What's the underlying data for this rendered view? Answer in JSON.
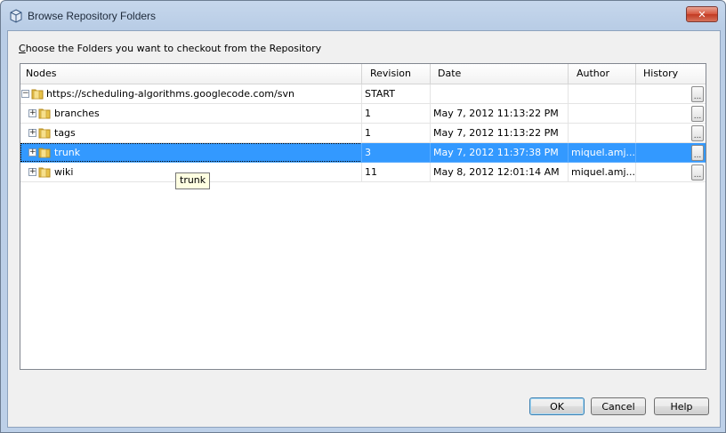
{
  "window": {
    "title": "Browse Repository Folders",
    "close_glyph": "✕"
  },
  "instruction": {
    "prefix": "C",
    "rest": "hoose the Folders you want to checkout from the Repository"
  },
  "table": {
    "columns": [
      "Nodes",
      "Revision",
      "Date",
      "Author",
      "History"
    ],
    "rows": [
      {
        "node": "https://scheduling-algorithms.googlecode.com/svn",
        "expander": "−",
        "revision": "START",
        "date": "",
        "author": "",
        "history": "..."
      },
      {
        "node": "branches",
        "expander": "+",
        "revision": "1",
        "date": "May 7, 2012 11:13:22 PM",
        "author": "",
        "history": "..."
      },
      {
        "node": "tags",
        "expander": "+",
        "revision": "1",
        "date": "May 7, 2012 11:13:22 PM",
        "author": "",
        "history": "..."
      },
      {
        "node": "trunk",
        "expander": "+",
        "revision": "3",
        "date": "May 7, 2012 11:37:38 PM",
        "author": "miquel.amj...",
        "history": "...",
        "selected": true
      },
      {
        "node": "wiki",
        "expander": "+",
        "revision": "11",
        "date": "May 8, 2012 12:01:14 AM",
        "author": "miquel.amj...",
        "history": "..."
      }
    ]
  },
  "tooltip": {
    "text": "trunk"
  },
  "buttons": {
    "ok": "OK",
    "cancel": "Cancel",
    "help": "Help"
  },
  "colors": {
    "selection": "#3399ff",
    "tooltip_bg": "#ffffe1",
    "folder": "#e8c34a"
  }
}
